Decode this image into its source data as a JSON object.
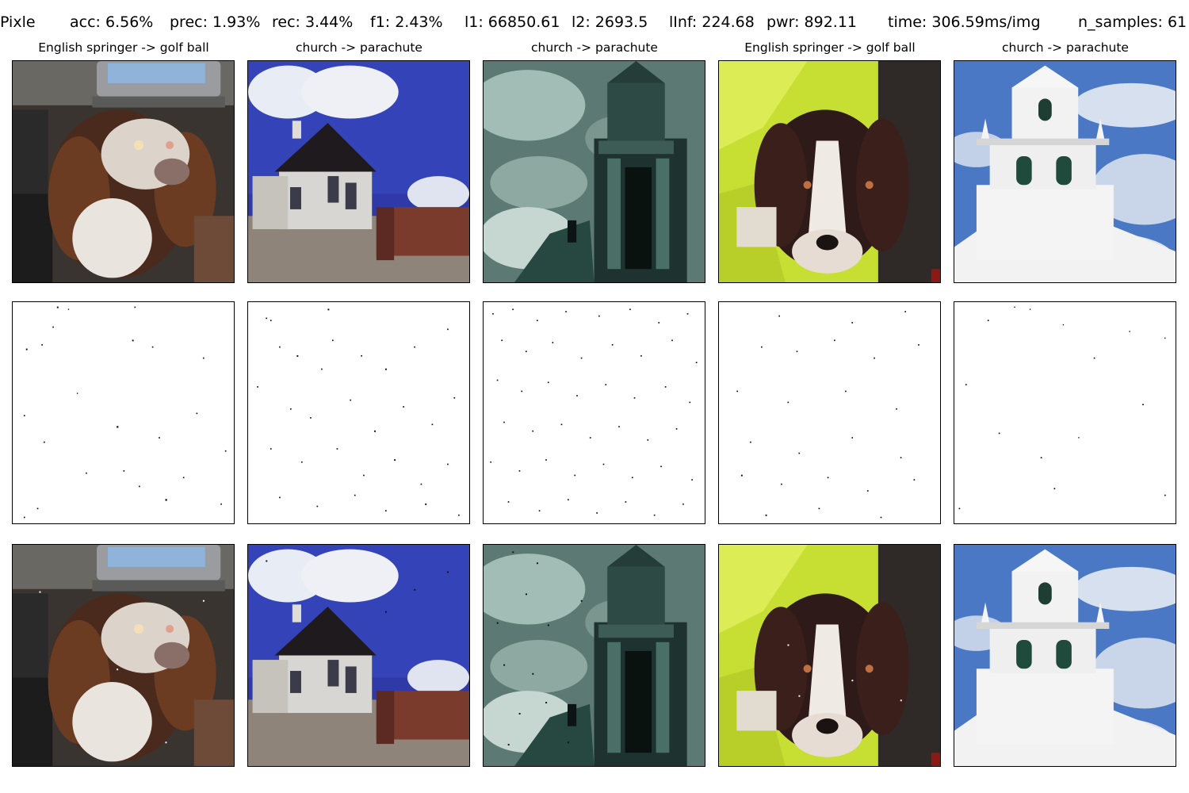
{
  "header": {
    "method": "Pixle",
    "acc": "acc: 6.56%",
    "prec": "prec: 1.93%",
    "rec": "rec: 3.44%",
    "f1": "f1: 2.43%",
    "l1": "l1: 66850.61",
    "l2": "l2: 2693.5",
    "linf": "lInf: 224.68",
    "pwr": "pwr: 892.11",
    "time": "time: 306.59ms/img",
    "n_samples": "n_samples: 61"
  },
  "columns": [
    {
      "title": "English springer -> golf ball",
      "subject": "springer-dog-living-room"
    },
    {
      "title": "church -> parachute",
      "subject": "white-church-blue-sky"
    },
    {
      "title": "church -> parachute",
      "subject": "church-tower-cloudy-sky"
    },
    {
      "title": "English springer -> golf ball",
      "subject": "springer-dog-yellow-coat"
    },
    {
      "title": "church -> parachute",
      "subject": "white-steeple-sky"
    }
  ],
  "rows": [
    "original-image",
    "perturbation-map",
    "adversarial-image"
  ]
}
